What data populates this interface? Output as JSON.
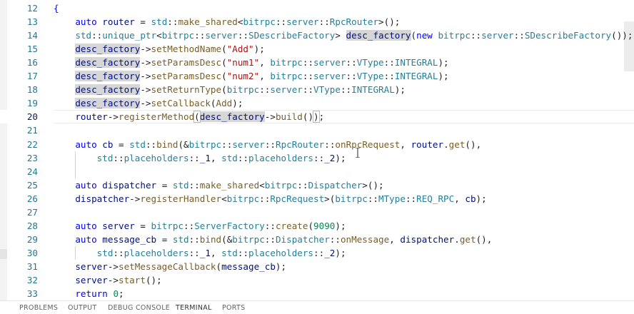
{
  "editor": {
    "lines": [
      {
        "n": "12",
        "tokens": [
          {
            "t": "{",
            "c": "kw"
          }
        ]
      },
      {
        "n": "13",
        "tokens": [
          {
            "t": "    ",
            "c": "pl"
          },
          {
            "t": "auto",
            "c": "kw"
          },
          {
            "t": " ",
            "c": "pl"
          },
          {
            "t": "router",
            "c": "id"
          },
          {
            "t": " = ",
            "c": "pl"
          },
          {
            "t": "std",
            "c": "ty"
          },
          {
            "t": "::",
            "c": "pl"
          },
          {
            "t": "make_shared",
            "c": "fn"
          },
          {
            "t": "<",
            "c": "pl"
          },
          {
            "t": "bitrpc",
            "c": "ty"
          },
          {
            "t": "::",
            "c": "pl"
          },
          {
            "t": "server",
            "c": "ty"
          },
          {
            "t": "::",
            "c": "pl"
          },
          {
            "t": "RpcRouter",
            "c": "ty"
          },
          {
            "t": ">();",
            "c": "pl"
          }
        ]
      },
      {
        "n": "14",
        "tokens": [
          {
            "t": "    ",
            "c": "pl"
          },
          {
            "t": "std",
            "c": "ty"
          },
          {
            "t": "::",
            "c": "pl"
          },
          {
            "t": "unique_ptr",
            "c": "ty"
          },
          {
            "t": "<",
            "c": "pl"
          },
          {
            "t": "bitrpc",
            "c": "ty"
          },
          {
            "t": "::",
            "c": "pl"
          },
          {
            "t": "server",
            "c": "ty"
          },
          {
            "t": "::",
            "c": "pl"
          },
          {
            "t": "SDescribeFactory",
            "c": "ty"
          },
          {
            "t": "> ",
            "c": "pl"
          },
          {
            "t": "desc_factory",
            "c": "id",
            "hl": true
          },
          {
            "t": "(",
            "c": "pl"
          },
          {
            "t": "new",
            "c": "kw"
          },
          {
            "t": " ",
            "c": "pl"
          },
          {
            "t": "bitrpc",
            "c": "ty"
          },
          {
            "t": "::",
            "c": "pl"
          },
          {
            "t": "server",
            "c": "ty"
          },
          {
            "t": "::",
            "c": "pl"
          },
          {
            "t": "SDescribeFactory",
            "c": "ty"
          },
          {
            "t": "());",
            "c": "pl"
          }
        ]
      },
      {
        "n": "15",
        "tokens": [
          {
            "t": "    ",
            "c": "pl"
          },
          {
            "t": "desc_factory",
            "c": "id",
            "hl": true
          },
          {
            "t": "->",
            "c": "pl"
          },
          {
            "t": "setMethodName",
            "c": "fn"
          },
          {
            "t": "(",
            "c": "pl"
          },
          {
            "t": "\"Add\"",
            "c": "str"
          },
          {
            "t": ");",
            "c": "pl"
          }
        ]
      },
      {
        "n": "16",
        "tokens": [
          {
            "t": "    ",
            "c": "pl"
          },
          {
            "t": "desc_factory",
            "c": "id",
            "hl": true
          },
          {
            "t": "->",
            "c": "pl"
          },
          {
            "t": "setParamsDesc",
            "c": "fn"
          },
          {
            "t": "(",
            "c": "pl"
          },
          {
            "t": "\"num1\"",
            "c": "str"
          },
          {
            "t": ", ",
            "c": "pl"
          },
          {
            "t": "bitrpc",
            "c": "ty"
          },
          {
            "t": "::",
            "c": "pl"
          },
          {
            "t": "server",
            "c": "ty"
          },
          {
            "t": "::",
            "c": "pl"
          },
          {
            "t": "VType",
            "c": "ty"
          },
          {
            "t": "::",
            "c": "pl"
          },
          {
            "t": "INTEGRAL",
            "c": "ty"
          },
          {
            "t": ");",
            "c": "pl"
          }
        ]
      },
      {
        "n": "17",
        "tokens": [
          {
            "t": "    ",
            "c": "pl"
          },
          {
            "t": "desc_factory",
            "c": "id",
            "hl": true
          },
          {
            "t": "->",
            "c": "pl"
          },
          {
            "t": "setParamsDesc",
            "c": "fn"
          },
          {
            "t": "(",
            "c": "pl"
          },
          {
            "t": "\"num2\"",
            "c": "str"
          },
          {
            "t": ", ",
            "c": "pl"
          },
          {
            "t": "bitrpc",
            "c": "ty"
          },
          {
            "t": "::",
            "c": "pl"
          },
          {
            "t": "server",
            "c": "ty"
          },
          {
            "t": "::",
            "c": "pl"
          },
          {
            "t": "VType",
            "c": "ty"
          },
          {
            "t": "::",
            "c": "pl"
          },
          {
            "t": "INTEGRAL",
            "c": "ty"
          },
          {
            "t": ");",
            "c": "pl"
          }
        ]
      },
      {
        "n": "18",
        "tokens": [
          {
            "t": "    ",
            "c": "pl"
          },
          {
            "t": "desc_factory",
            "c": "id",
            "hl": true
          },
          {
            "t": "->",
            "c": "pl"
          },
          {
            "t": "setReturnType",
            "c": "fn"
          },
          {
            "t": "(",
            "c": "pl"
          },
          {
            "t": "bitrpc",
            "c": "ty"
          },
          {
            "t": "::",
            "c": "pl"
          },
          {
            "t": "server",
            "c": "ty"
          },
          {
            "t": "::",
            "c": "pl"
          },
          {
            "t": "VType",
            "c": "ty"
          },
          {
            "t": "::",
            "c": "pl"
          },
          {
            "t": "INTEGRAL",
            "c": "ty"
          },
          {
            "t": ");",
            "c": "pl"
          }
        ]
      },
      {
        "n": "19",
        "tokens": [
          {
            "t": "    ",
            "c": "pl"
          },
          {
            "t": "desc_factory",
            "c": "id",
            "hl": true
          },
          {
            "t": "->",
            "c": "pl"
          },
          {
            "t": "setCallback",
            "c": "fn"
          },
          {
            "t": "(",
            "c": "pl"
          },
          {
            "t": "Add",
            "c": "fn"
          },
          {
            "t": ");",
            "c": "pl"
          }
        ]
      },
      {
        "n": "20",
        "tokens": [
          {
            "t": "    ",
            "c": "pl"
          },
          {
            "t": "router",
            "c": "id"
          },
          {
            "t": "->",
            "c": "pl"
          },
          {
            "t": "registerMethod",
            "c": "fn"
          },
          {
            "t": "(",
            "c": "pl",
            "brk": true
          },
          {
            "t": "desc_factory",
            "c": "id",
            "hl": true
          },
          {
            "t": "->",
            "c": "pl"
          },
          {
            "t": "build",
            "c": "fn"
          },
          {
            "t": "()",
            "c": "pl"
          },
          {
            "t": ")",
            "c": "pl",
            "brk": true
          },
          {
            "t": ";",
            "c": "pl"
          }
        ],
        "active": true
      },
      {
        "n": "21",
        "tokens": []
      },
      {
        "n": "22",
        "tokens": [
          {
            "t": "    ",
            "c": "pl"
          },
          {
            "t": "auto",
            "c": "kw"
          },
          {
            "t": " ",
            "c": "pl"
          },
          {
            "t": "cb",
            "c": "id"
          },
          {
            "t": " = ",
            "c": "pl"
          },
          {
            "t": "std",
            "c": "ty"
          },
          {
            "t": "::",
            "c": "pl"
          },
          {
            "t": "bind",
            "c": "fn"
          },
          {
            "t": "(&",
            "c": "pl"
          },
          {
            "t": "bitrpc",
            "c": "ty"
          },
          {
            "t": "::",
            "c": "pl"
          },
          {
            "t": "server",
            "c": "ty"
          },
          {
            "t": "::",
            "c": "pl"
          },
          {
            "t": "RpcRouter",
            "c": "ty"
          },
          {
            "t": "::",
            "c": "pl"
          },
          {
            "t": "onRpcRequest",
            "c": "fn"
          },
          {
            "t": ", ",
            "c": "pl"
          },
          {
            "t": "router",
            "c": "id"
          },
          {
            "t": ".",
            "c": "pl"
          },
          {
            "t": "get",
            "c": "fn"
          },
          {
            "t": "(),",
            "c": "pl"
          }
        ]
      },
      {
        "n": "23",
        "tokens": [
          {
            "t": "        ",
            "c": "pl"
          },
          {
            "t": "std",
            "c": "ty"
          },
          {
            "t": "::",
            "c": "pl"
          },
          {
            "t": "placeholders",
            "c": "ty"
          },
          {
            "t": "::",
            "c": "pl"
          },
          {
            "t": "_1",
            "c": "id"
          },
          {
            "t": ", ",
            "c": "pl"
          },
          {
            "t": "std",
            "c": "ty"
          },
          {
            "t": "::",
            "c": "pl"
          },
          {
            "t": "placeholders",
            "c": "ty"
          },
          {
            "t": "::",
            "c": "pl"
          },
          {
            "t": "_2",
            "c": "id"
          },
          {
            "t": ");",
            "c": "pl"
          }
        ]
      },
      {
        "n": "24",
        "tokens": []
      },
      {
        "n": "25",
        "tokens": [
          {
            "t": "    ",
            "c": "pl"
          },
          {
            "t": "auto",
            "c": "kw"
          },
          {
            "t": " ",
            "c": "pl"
          },
          {
            "t": "dispatcher",
            "c": "id"
          },
          {
            "t": " = ",
            "c": "pl"
          },
          {
            "t": "std",
            "c": "ty"
          },
          {
            "t": "::",
            "c": "pl"
          },
          {
            "t": "make_shared",
            "c": "fn"
          },
          {
            "t": "<",
            "c": "pl"
          },
          {
            "t": "bitrpc",
            "c": "ty"
          },
          {
            "t": "::",
            "c": "pl"
          },
          {
            "t": "Dispatcher",
            "c": "ty"
          },
          {
            "t": ">();",
            "c": "pl"
          }
        ]
      },
      {
        "n": "26",
        "tokens": [
          {
            "t": "    ",
            "c": "pl"
          },
          {
            "t": "dispatcher",
            "c": "id"
          },
          {
            "t": "->",
            "c": "pl"
          },
          {
            "t": "registerHandler",
            "c": "fn"
          },
          {
            "t": "<",
            "c": "pl"
          },
          {
            "t": "bitrpc",
            "c": "ty"
          },
          {
            "t": "::",
            "c": "pl"
          },
          {
            "t": "RpcRequest",
            "c": "ty"
          },
          {
            "t": ">(",
            "c": "pl"
          },
          {
            "t": "bitrpc",
            "c": "ty"
          },
          {
            "t": "::",
            "c": "pl"
          },
          {
            "t": "MType",
            "c": "ty"
          },
          {
            "t": "::",
            "c": "pl"
          },
          {
            "t": "REQ_RPC",
            "c": "ty"
          },
          {
            "t": ", ",
            "c": "pl"
          },
          {
            "t": "cb",
            "c": "id"
          },
          {
            "t": ");",
            "c": "pl"
          }
        ]
      },
      {
        "n": "27",
        "tokens": []
      },
      {
        "n": "28",
        "tokens": [
          {
            "t": "    ",
            "c": "pl"
          },
          {
            "t": "auto",
            "c": "kw"
          },
          {
            "t": " ",
            "c": "pl"
          },
          {
            "t": "server",
            "c": "id"
          },
          {
            "t": " = ",
            "c": "pl"
          },
          {
            "t": "bitrpc",
            "c": "ty"
          },
          {
            "t": "::",
            "c": "pl"
          },
          {
            "t": "ServerFactory",
            "c": "ty"
          },
          {
            "t": "::",
            "c": "pl"
          },
          {
            "t": "create",
            "c": "fn"
          },
          {
            "t": "(",
            "c": "pl"
          },
          {
            "t": "9090",
            "c": "num"
          },
          {
            "t": ");",
            "c": "pl"
          }
        ]
      },
      {
        "n": "29",
        "tokens": [
          {
            "t": "    ",
            "c": "pl"
          },
          {
            "t": "auto",
            "c": "kw"
          },
          {
            "t": " ",
            "c": "pl"
          },
          {
            "t": "message_cb",
            "c": "id"
          },
          {
            "t": " = ",
            "c": "pl"
          },
          {
            "t": "std",
            "c": "ty"
          },
          {
            "t": "::",
            "c": "pl"
          },
          {
            "t": "bind",
            "c": "fn"
          },
          {
            "t": "(&",
            "c": "pl"
          },
          {
            "t": "bitrpc",
            "c": "ty"
          },
          {
            "t": "::",
            "c": "pl"
          },
          {
            "t": "Dispatcher",
            "c": "ty"
          },
          {
            "t": "::",
            "c": "pl"
          },
          {
            "t": "onMessage",
            "c": "fn"
          },
          {
            "t": ", ",
            "c": "pl"
          },
          {
            "t": "dispatcher",
            "c": "id"
          },
          {
            "t": ".",
            "c": "pl"
          },
          {
            "t": "get",
            "c": "fn"
          },
          {
            "t": "(),",
            "c": "pl"
          }
        ]
      },
      {
        "n": "30",
        "tokens": [
          {
            "t": "        ",
            "c": "pl"
          },
          {
            "t": "std",
            "c": "ty"
          },
          {
            "t": "::",
            "c": "pl"
          },
          {
            "t": "placeholders",
            "c": "ty"
          },
          {
            "t": "::",
            "c": "pl"
          },
          {
            "t": "_1",
            "c": "id"
          },
          {
            "t": ", ",
            "c": "pl"
          },
          {
            "t": "std",
            "c": "ty"
          },
          {
            "t": "::",
            "c": "pl"
          },
          {
            "t": "placeholders",
            "c": "ty"
          },
          {
            "t": "::",
            "c": "pl"
          },
          {
            "t": "_2",
            "c": "id"
          },
          {
            "t": ");",
            "c": "pl"
          }
        ]
      },
      {
        "n": "31",
        "tokens": [
          {
            "t": "    ",
            "c": "pl"
          },
          {
            "t": "server",
            "c": "id"
          },
          {
            "t": "->",
            "c": "pl"
          },
          {
            "t": "setMessageCallback",
            "c": "fn"
          },
          {
            "t": "(",
            "c": "pl"
          },
          {
            "t": "message_cb",
            "c": "id"
          },
          {
            "t": ");",
            "c": "pl"
          }
        ]
      },
      {
        "n": "32",
        "tokens": [
          {
            "t": "    ",
            "c": "pl"
          },
          {
            "t": "server",
            "c": "id"
          },
          {
            "t": "->",
            "c": "pl"
          },
          {
            "t": "start",
            "c": "fn"
          },
          {
            "t": "();",
            "c": "pl"
          }
        ]
      },
      {
        "n": "33",
        "tokens": [
          {
            "t": "    ",
            "c": "pl"
          },
          {
            "t": "return",
            "c": "kw"
          },
          {
            "t": " ",
            "c": "pl"
          },
          {
            "t": "0",
            "c": "num"
          },
          {
            "t": ";",
            "c": "pl"
          }
        ]
      }
    ]
  },
  "panel": {
    "tabs": [
      {
        "label": "PROBLEMS"
      },
      {
        "label": "OUTPUT"
      },
      {
        "label": "DEBUG CONSOLE"
      },
      {
        "label": "TERMINAL",
        "active": true
      },
      {
        "label": "PORTS"
      }
    ]
  },
  "colors": {
    "keyword": "#0000ff",
    "type": "#267f99",
    "function": "#795e26",
    "string": "#a31515",
    "number": "#098658",
    "identifier": "#001080",
    "line_number": "#237893",
    "highlight": "#d6d6d6"
  }
}
